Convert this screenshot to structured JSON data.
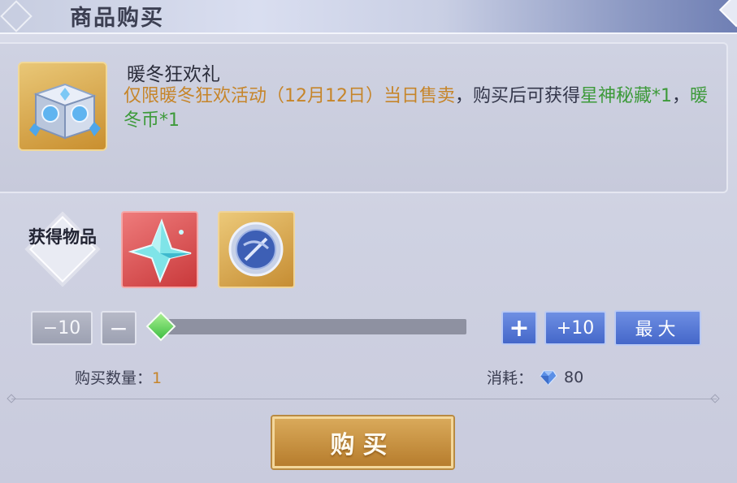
{
  "header": {
    "title": "商品购买"
  },
  "item": {
    "name": "暖冬狂欢礼",
    "desc_part1": "仅限暖冬狂欢活动（12月12日）当日售卖",
    "desc_part2": "，购买后可获得",
    "desc_reward1": "星神秘藏*1",
    "desc_sep": "，",
    "desc_reward2": "暖冬币*1"
  },
  "rewards": {
    "label": "获得物品",
    "items": [
      {
        "icon": "star-crystal-icon",
        "rarity_color": "#d9494b"
      },
      {
        "icon": "winter-coin-icon",
        "rarity_color": "#d59f43"
      }
    ]
  },
  "quantity": {
    "minus10_label": "−10",
    "minus_label": "−",
    "plus_label": "+",
    "plus10_label": "+10",
    "max_label": "最大",
    "label": "购买数量：",
    "value": "1"
  },
  "cost": {
    "label": "消耗：",
    "icon": "diamond-gem-icon",
    "value": "80"
  },
  "buy_button": {
    "label": "购买"
  },
  "colors": {
    "accent_gold": "#c6852a",
    "reward_green": "#3d9a3a",
    "button_blue": "#4f72d2",
    "slider_handle": "#52c94c"
  }
}
